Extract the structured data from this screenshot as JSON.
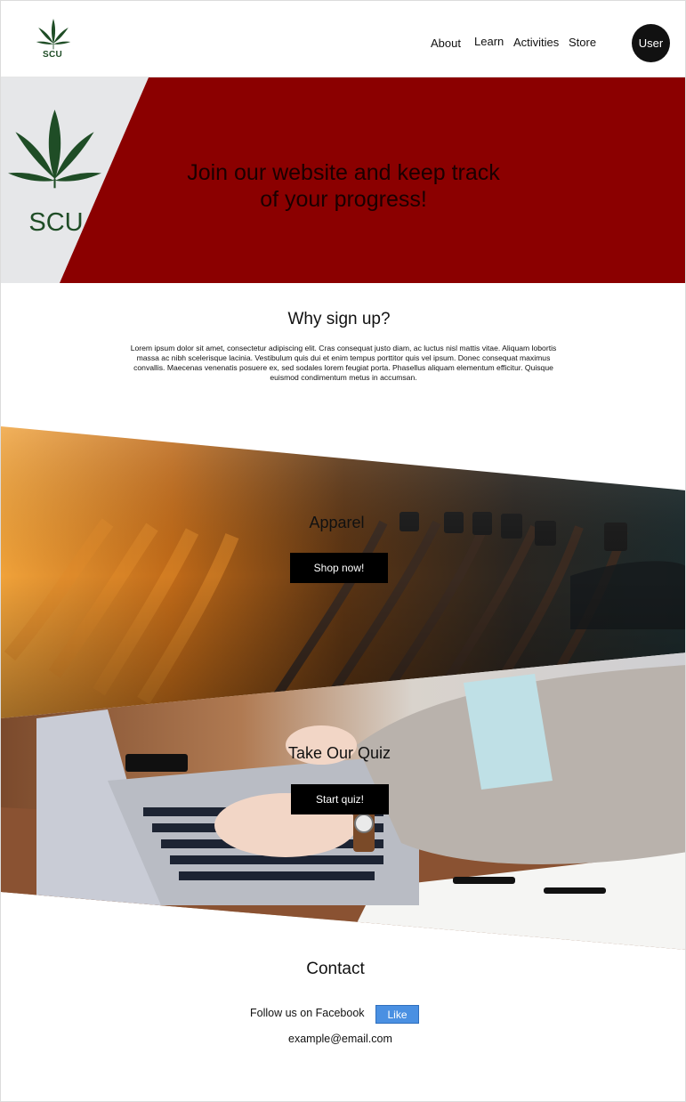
{
  "header": {
    "logo_text": "SCU",
    "nav": {
      "about": "About",
      "learn": "Learn",
      "activities": "Activities",
      "store": "Store"
    },
    "user_label": "User"
  },
  "hero": {
    "logo_text": "SCU",
    "title": "Join our website and keep track of your progress!"
  },
  "why": {
    "title": "Why sign up?",
    "body": "Lorem ipsum dolor sit amet, consectetur adipiscing elit. Cras consequat justo diam, ac luctus nisl mattis vitae. Aliquam lobortis massa ac nibh scelerisque lacinia. Vestibulum quis dui et enim tempus porttitor quis vel ipsum. Donec consequat maximus convallis. Maecenas venenatis posuere ex, sed sodales lorem feugiat porta. Phasellus aliquam elementum efficitur. Quisque euismod condimentum metus in accumsan."
  },
  "apparel": {
    "title": "Apparel",
    "button": "Shop now!"
  },
  "quiz": {
    "title": "Take Our Quiz",
    "button": "Start quiz!"
  },
  "contact": {
    "title": "Contact",
    "follow": "Follow us on Facebook",
    "like": "Like",
    "email": "example@email.com"
  },
  "colors": {
    "brand_red": "#8b0000",
    "leaf_green": "#1f4d26",
    "like_blue": "#4a90e2"
  }
}
